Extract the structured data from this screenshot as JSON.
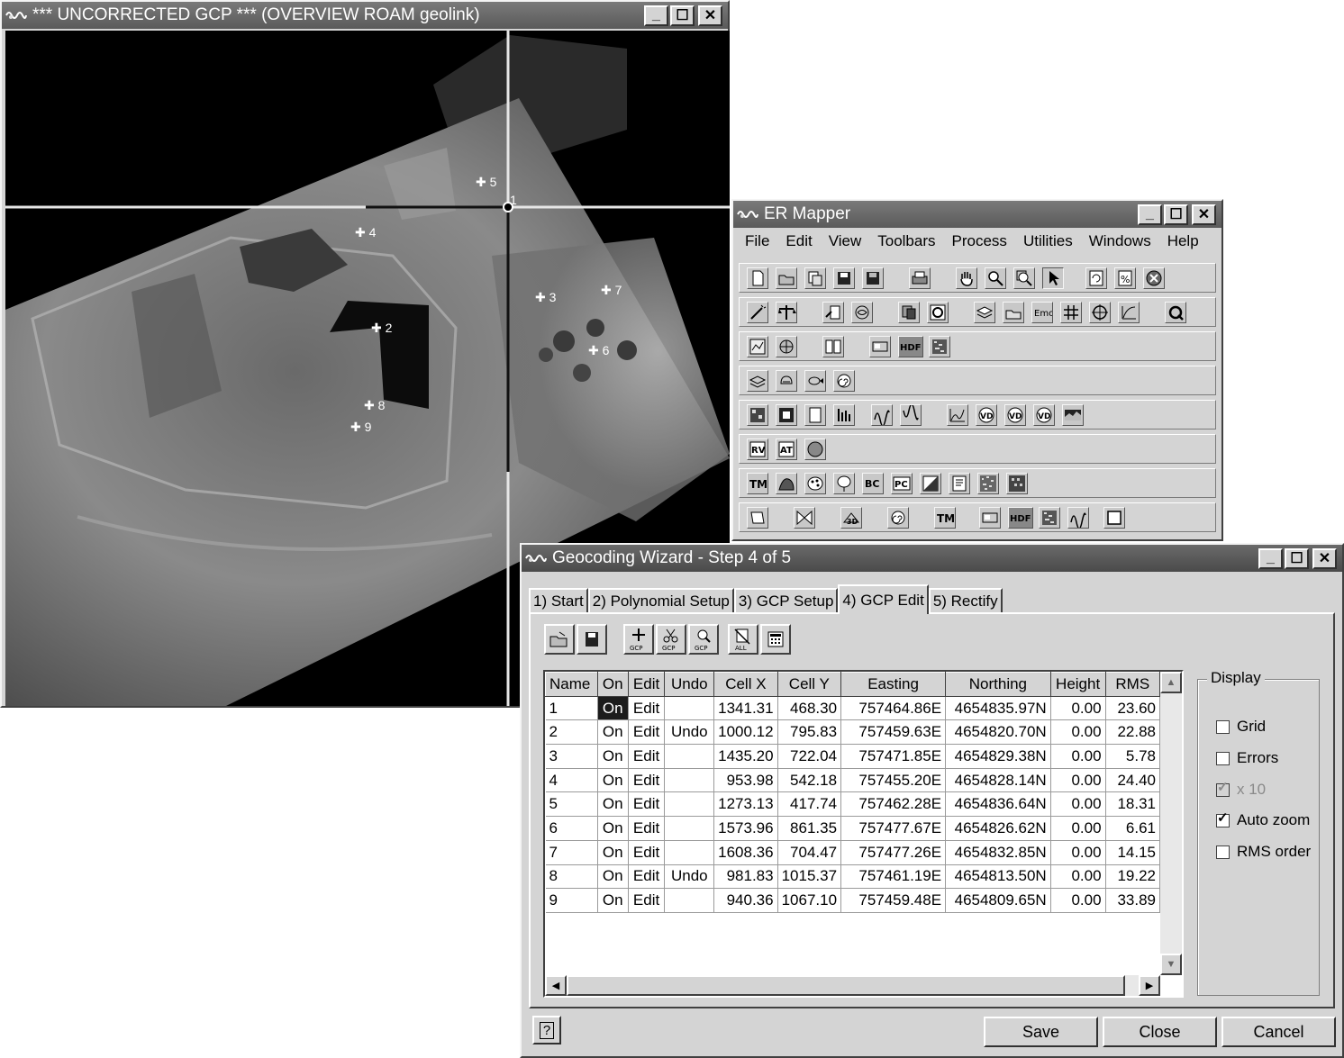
{
  "overview_window": {
    "title": "*** UNCORRECTED GCP *** (OVERVIEW ROAM geolink)",
    "gcp_labels": [
      "1",
      "2",
      "3",
      "4",
      "5",
      "6",
      "7",
      "8",
      "9"
    ]
  },
  "ermapper_window": {
    "title": "ER Mapper",
    "menu": [
      "File",
      "Edit",
      "View",
      "Toolbars",
      "Process",
      "Utilities",
      "Windows",
      "Help"
    ],
    "toolbar_labels": {
      "hdf": "HDF",
      "emc": "Emc"
    }
  },
  "wizard_window": {
    "title": "Geocoding Wizard - Step 4 of 5",
    "tabs": [
      "1) Start",
      "2) Polynomial Setup",
      "3) GCP Setup",
      "4) GCP Edit",
      "5) Rectify"
    ],
    "active_tab": "4) GCP Edit",
    "icon_button_captions": {
      "add": "GCP",
      "cut": "GCP",
      "find": "GCP",
      "all": "ALL"
    },
    "table": {
      "columns": [
        "Name",
        "On",
        "Edit",
        "Undo",
        "Cell X",
        "Cell Y",
        "Easting",
        "Northing",
        "Height",
        "RMS"
      ],
      "rows": [
        {
          "name": "1",
          "on": "On",
          "edit": "Edit",
          "undo": "",
          "cellx": "1341.31",
          "celly": "468.30",
          "easting": "757464.86E",
          "northing": "4654835.97N",
          "height": "0.00",
          "rms": "23.60"
        },
        {
          "name": "2",
          "on": "On",
          "edit": "Edit",
          "undo": "Undo",
          "cellx": "1000.12",
          "celly": "795.83",
          "easting": "757459.63E",
          "northing": "4654820.70N",
          "height": "0.00",
          "rms": "22.88"
        },
        {
          "name": "3",
          "on": "On",
          "edit": "Edit",
          "undo": "",
          "cellx": "1435.20",
          "celly": "722.04",
          "easting": "757471.85E",
          "northing": "4654829.38N",
          "height": "0.00",
          "rms": "5.78"
        },
        {
          "name": "4",
          "on": "On",
          "edit": "Edit",
          "undo": "",
          "cellx": "953.98",
          "celly": "542.18",
          "easting": "757455.20E",
          "northing": "4654828.14N",
          "height": "0.00",
          "rms": "24.40"
        },
        {
          "name": "5",
          "on": "On",
          "edit": "Edit",
          "undo": "",
          "cellx": "1273.13",
          "celly": "417.74",
          "easting": "757462.28E",
          "northing": "4654836.64N",
          "height": "0.00",
          "rms": "18.31"
        },
        {
          "name": "6",
          "on": "On",
          "edit": "Edit",
          "undo": "",
          "cellx": "1573.96",
          "celly": "861.35",
          "easting": "757477.67E",
          "northing": "4654826.62N",
          "height": "0.00",
          "rms": "6.61"
        },
        {
          "name": "7",
          "on": "On",
          "edit": "Edit",
          "undo": "",
          "cellx": "1608.36",
          "celly": "704.47",
          "easting": "757477.26E",
          "northing": "4654832.85N",
          "height": "0.00",
          "rms": "14.15"
        },
        {
          "name": "8",
          "on": "On",
          "edit": "Edit",
          "undo": "Undo",
          "cellx": "981.83",
          "celly": "1015.37",
          "easting": "757461.19E",
          "northing": "4654813.50N",
          "height": "0.00",
          "rms": "19.22"
        },
        {
          "name": "9",
          "on": "On",
          "edit": "Edit",
          "undo": "",
          "cellx": "940.36",
          "celly": "1067.10",
          "easting": "757459.48E",
          "northing": "4654809.65N",
          "height": "0.00",
          "rms": "33.89"
        }
      ]
    },
    "display": {
      "legend": "Display",
      "options": [
        {
          "label": "Grid",
          "checked": false,
          "enabled": true
        },
        {
          "label": "Errors",
          "checked": false,
          "enabled": true
        },
        {
          "label": "x 10",
          "checked": true,
          "enabled": false
        },
        {
          "label": "Auto zoom",
          "checked": true,
          "enabled": true
        },
        {
          "label": "RMS order",
          "checked": false,
          "enabled": true
        }
      ]
    },
    "help_label": "?",
    "buttons": {
      "save": "Save",
      "close": "Close",
      "cancel": "Cancel"
    }
  }
}
